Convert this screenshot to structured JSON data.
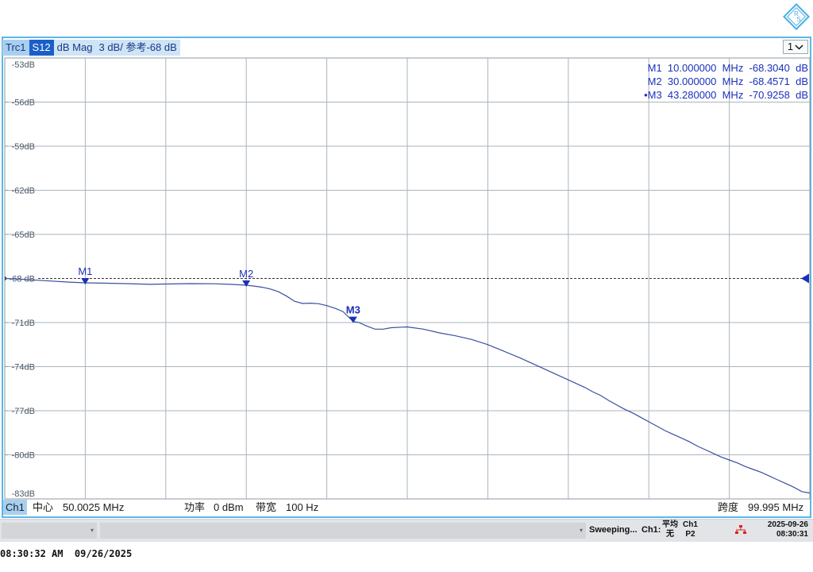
{
  "trace_header": {
    "trc": "Trc1",
    "s_param": "S12",
    "format": "dB Mag",
    "scale": "3 dB/ 参考-68 dB"
  },
  "window_select": {
    "value": "1",
    "icon": "chevron-down-icon"
  },
  "markers": [
    {
      "label": "M1",
      "line": "M1  10.000000  MHz  -68.3040  dB",
      "freq_mhz": 10.0,
      "value_db": -68.304,
      "active": false
    },
    {
      "label": "M2",
      "line": "M2  30.000000  MHz  -68.4571  dB",
      "freq_mhz": 30.0,
      "value_db": -68.4571,
      "active": false
    },
    {
      "label": "M3",
      "line": "•M3  43.280000  MHz  -70.9258  dB",
      "freq_mhz": 43.28,
      "value_db": -70.9258,
      "active": true
    }
  ],
  "reference": {
    "label": "-68 dB",
    "value_db": -68,
    "color": "#1a30b8"
  },
  "chart_data": {
    "type": "line",
    "y_tick_labels": [
      "-53dB",
      "-56dB",
      "-59dB",
      "-62dB",
      "-65dB",
      "-68 dB",
      "-71dB",
      "-74dB",
      "-77dB",
      "-80dB",
      "-83dB"
    ],
    "ylim": [
      -83,
      -53
    ],
    "xlim": [
      0.005,
      100.0
    ],
    "grid": true,
    "series": [
      {
        "color": "#3a4fa3",
        "x": [
          0.005,
          2,
          5,
          8,
          10,
          12,
          15,
          18,
          20,
          23,
          26,
          28,
          30,
          31,
          32,
          33,
          34,
          35,
          36,
          37,
          38,
          39,
          40,
          41,
          42,
          43.28,
          44,
          45,
          46,
          47,
          48,
          50,
          52,
          54,
          56,
          58,
          60,
          62,
          64,
          66,
          68,
          70,
          72,
          73,
          74,
          75,
          76,
          77,
          78,
          79,
          80,
          81,
          82,
          83,
          84,
          85,
          86,
          87,
          88,
          89,
          90,
          91,
          92,
          93,
          94,
          95,
          96,
          97,
          98,
          99,
          99.995
        ],
        "y": [
          -68.0,
          -68.05,
          -68.15,
          -68.25,
          -68.3,
          -68.32,
          -68.35,
          -68.4,
          -68.38,
          -68.35,
          -68.36,
          -68.4,
          -68.46,
          -68.52,
          -68.6,
          -68.72,
          -68.9,
          -69.2,
          -69.55,
          -69.7,
          -69.68,
          -69.72,
          -69.85,
          -70.02,
          -70.25,
          -70.93,
          -71.0,
          -71.25,
          -71.45,
          -71.45,
          -71.35,
          -71.3,
          -71.45,
          -71.7,
          -71.9,
          -72.15,
          -72.5,
          -72.95,
          -73.4,
          -73.9,
          -74.4,
          -74.9,
          -75.4,
          -75.7,
          -75.95,
          -76.3,
          -76.6,
          -76.9,
          -77.15,
          -77.45,
          -77.75,
          -78.05,
          -78.35,
          -78.6,
          -78.85,
          -79.1,
          -79.4,
          -79.65,
          -79.9,
          -80.15,
          -80.35,
          -80.55,
          -80.8,
          -81.0,
          -81.2,
          -81.45,
          -81.7,
          -81.95,
          -82.2,
          -82.5,
          -82.6
        ]
      }
    ]
  },
  "x_axis_px": {
    "note": "unused"
  },
  "footer": {
    "channel": "Ch1",
    "center_label": "中心",
    "center_value": "50.0025 MHz",
    "power_label": "功率",
    "power_value": "0 dBm",
    "bw_label": "带宽",
    "bw_value": "100 Hz",
    "span_label": "跨度",
    "span_value": "99.995 MHz"
  },
  "status_bar": {
    "sweep": "Sweeping...",
    "ch": "Ch1:",
    "avg_top": "平均",
    "avg_bottom": "无",
    "port_top": "Ch1",
    "port_bottom": "P2",
    "date": "2025-09-26",
    "time": "08:30:31",
    "lan_color": "#d9251d"
  },
  "os_clock": "08:30:32 AM  09/26/2025"
}
